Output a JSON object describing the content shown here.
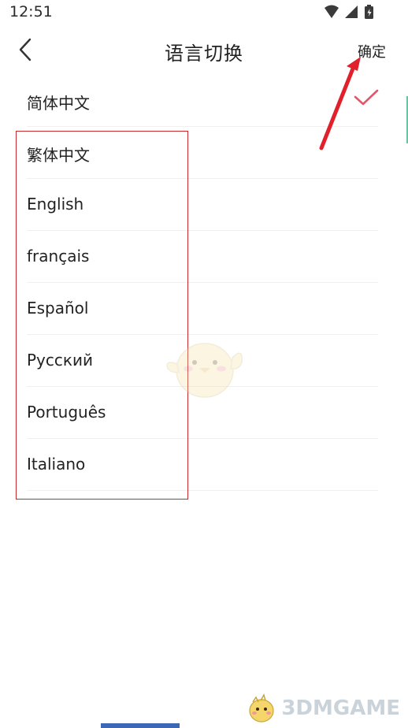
{
  "status_bar": {
    "time": "12:51"
  },
  "nav": {
    "title": "语言切换",
    "confirm_label": "确定"
  },
  "languages": [
    {
      "label": "简体中文",
      "selected": true
    },
    {
      "label": "繁体中文",
      "selected": false
    },
    {
      "label": "English",
      "selected": false
    },
    {
      "label": "français",
      "selected": false
    },
    {
      "label": "Español",
      "selected": false
    },
    {
      "label": "Русский",
      "selected": false
    },
    {
      "label": "Português",
      "selected": false
    },
    {
      "label": "Italiano",
      "selected": false
    }
  ],
  "colors": {
    "check": "#e0566a",
    "annotation": "#e0202a",
    "box": "#c9282d",
    "watermark": "#c9d3d9"
  },
  "watermark": {
    "text": "3DMGAME"
  }
}
